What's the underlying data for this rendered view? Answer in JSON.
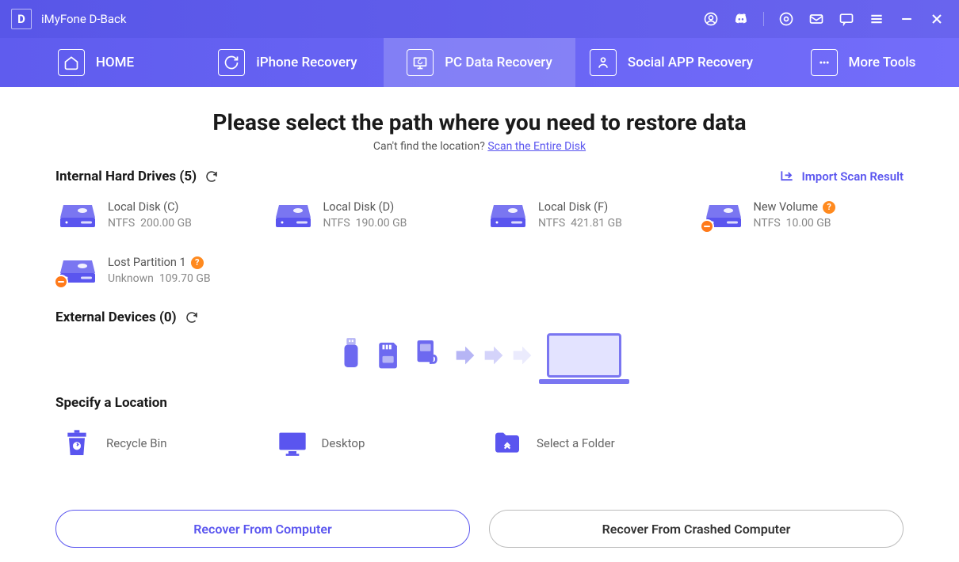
{
  "app": {
    "title": "iMyFone D-Back",
    "logo_letter": "D"
  },
  "nav": {
    "home": "HOME",
    "iphone": "iPhone Recovery",
    "pc": "PC Data Recovery",
    "social": "Social APP Recovery",
    "tools": "More Tools"
  },
  "main": {
    "heading": "Please select the path where you need to restore data",
    "sub_prefix": "Can't find the location? ",
    "sub_link": "Scan the Entire Disk",
    "internal_title": "Internal Hard Drives (5)",
    "import_label": "Import Scan Result",
    "external_title": "External Devices (0)",
    "specify_title": "Specify a Location"
  },
  "drives": [
    {
      "name": "Local Disk (C)",
      "fs": "NTFS",
      "size": "200.00 GB",
      "warn": false,
      "help": false
    },
    {
      "name": "Local Disk (D)",
      "fs": "NTFS",
      "size": "190.00 GB",
      "warn": false,
      "help": false
    },
    {
      "name": "Local Disk (F)",
      "fs": "NTFS",
      "size": "421.81 GB",
      "warn": false,
      "help": false
    },
    {
      "name": "New Volume",
      "fs": "NTFS",
      "size": "10.00 GB",
      "warn": true,
      "help": true
    },
    {
      "name": "Lost Partition 1",
      "fs": "Unknown",
      "size": "109.70 GB",
      "warn": true,
      "help": true
    }
  ],
  "locations": {
    "recycle": "Recycle Bin",
    "desktop": "Desktop",
    "folder": "Select a Folder"
  },
  "footer": {
    "recover_pc": "Recover From Computer",
    "recover_crashed": "Recover From Crashed Computer"
  }
}
